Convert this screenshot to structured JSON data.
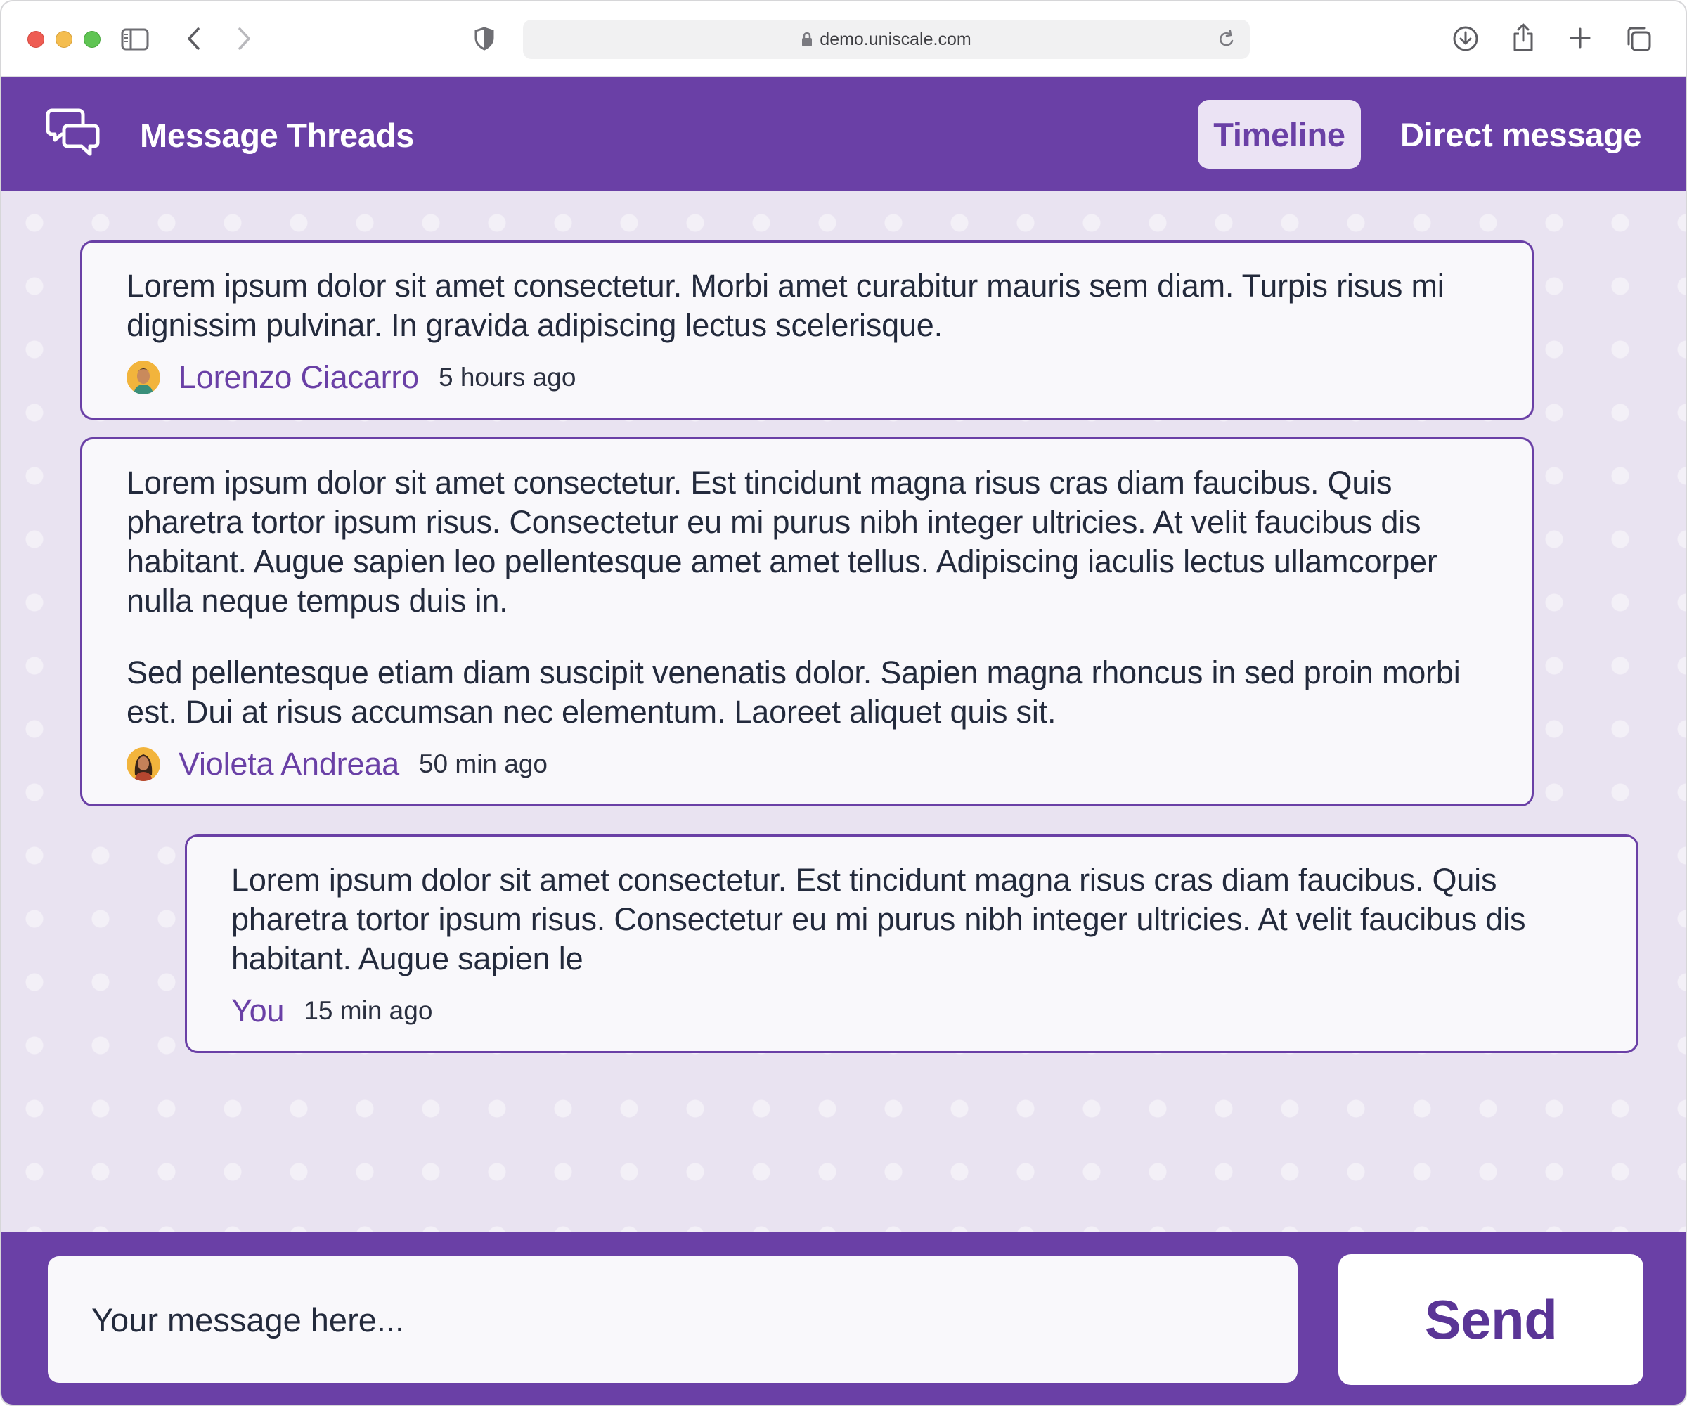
{
  "browser": {
    "url": "demo.uniscale.com",
    "icons": [
      "sidebar-icon",
      "back-icon",
      "forward-icon",
      "shield-icon",
      "lock-icon",
      "reload-icon",
      "download-icon",
      "share-icon",
      "new-tab-icon",
      "tabs-overview-icon"
    ]
  },
  "header": {
    "title": "Message Threads",
    "logo_icon": "chat-bubbles-icon",
    "tabs": [
      {
        "label": "Timeline",
        "active": true
      },
      {
        "label": "Direct message",
        "active": false
      }
    ]
  },
  "messages": [
    {
      "paragraphs": [
        "Lorem ipsum dolor sit amet consectetur. Morbi amet curabitur mauris sem diam. Turpis risus mi dignissim pulvinar. In gravida adipiscing lectus scelerisque."
      ],
      "author": "Lorenzo Ciacarro",
      "time": "5 hours ago",
      "avatar": "avatar-man"
    },
    {
      "paragraphs": [
        "Lorem ipsum dolor sit amet consectetur. Est tincidunt magna risus cras diam faucibus. Quis pharetra tortor ipsum risus. Consectetur eu mi purus nibh integer ultricies. At velit faucibus dis habitant. Augue sapien leo pellentesque amet amet tellus. Adipiscing iaculis lectus ullamcorper nulla neque tempus duis in.",
        "Sed pellentesque etiam diam suscipit venenatis dolor. Sapien magna rhoncus in sed proin morbi est. Dui at risus accumsan nec elementum. Laoreet aliquet quis sit."
      ],
      "author": "Violeta Andreaa",
      "time": "50 min ago",
      "avatar": "avatar-woman"
    },
    {
      "paragraphs": [
        "Lorem ipsum dolor sit amet consectetur. Est tincidunt magna risus cras diam faucibus. Quis pharetra tortor ipsum risus. Consectetur eu mi purus nibh integer ultricies. At velit faucibus dis habitant. Augue sapien le"
      ],
      "author": "You",
      "time": "15 min ago"
    }
  ],
  "composer": {
    "placeholder": "Your message here...",
    "send_label": "Send"
  },
  "colors": {
    "brand": "#6a40a6",
    "background": "#e9e3f1",
    "card": "#f9f8fb",
    "active_tab_bg": "#ebe3f4"
  }
}
